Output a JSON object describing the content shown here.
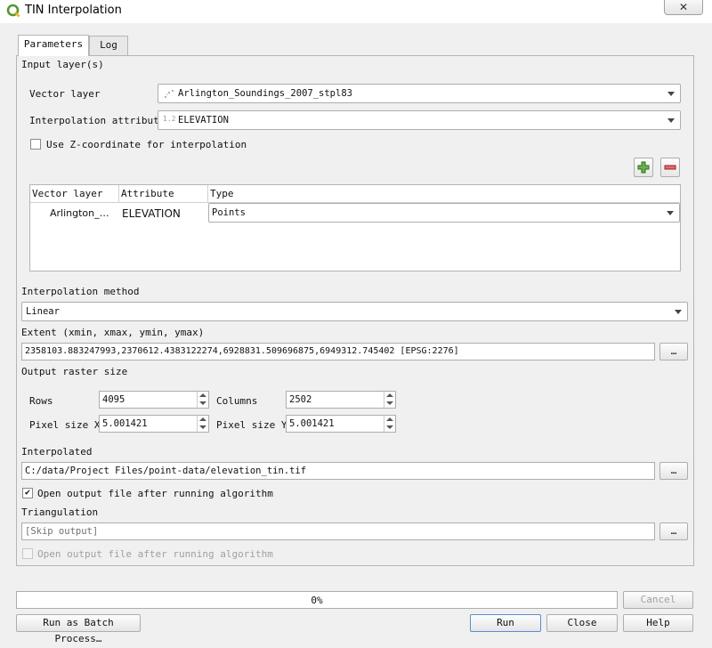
{
  "window": {
    "title": "TIN Interpolation",
    "close_glyph": "✕"
  },
  "tabs": [
    {
      "label": "Parameters",
      "active": true
    },
    {
      "label": "Log",
      "active": false
    }
  ],
  "params": {
    "input_layers_label": "Input layer(s)",
    "vector_layer_label": "Vector layer",
    "vector_layer_value": "Arlington_Soundings_2007_stpl83",
    "interp_attr_label": "Interpolation attribute",
    "interp_attr_prefix": "1.2",
    "interp_attr_value": "ELEVATION",
    "use_z_label": "Use Z-coordinate for interpolation",
    "use_z_checked": false,
    "table": {
      "headers": [
        "Vector layer",
        "Attribute",
        "Type"
      ],
      "rows": [
        {
          "layer": "Arlington_…",
          "attribute": "ELEVATION",
          "type": "Points"
        }
      ]
    },
    "method_label": "Interpolation method",
    "method_value": "Linear",
    "extent_label": "Extent (xmin, xmax, ymin, ymax)",
    "extent_value": "2358103.883247993,2370612.4383122274,6928831.509696875,6949312.745402 [EPSG:2276]",
    "raster_size_label": "Output raster size",
    "rows_label": "Rows",
    "rows_value": "4095",
    "columns_label": "Columns",
    "columns_value": "2502",
    "pixel_x_label": "Pixel size X",
    "pixel_x_value": "5.001421",
    "pixel_y_label": "Pixel size Y",
    "pixel_y_value": "5.001421",
    "interpolated_label": "Interpolated",
    "interpolated_value": "C:/data/Project Files/point-data/elevation_tin.tif",
    "open_output_label": "Open output file after running algorithm",
    "open_output_checked": "✔",
    "triangulation_label": "Triangulation",
    "triangulation_placeholder": "[Skip output]",
    "open_output2_label": "Open output file after running algorithm",
    "browse_label": "…"
  },
  "progress": {
    "text": "0%",
    "value": 0
  },
  "buttons": {
    "cancel": "Cancel",
    "batch": "Run as Batch Process…",
    "run": "Run",
    "close": "Close",
    "help": "Help"
  },
  "colors": {
    "qgis_green": "#589632",
    "remove_red": "#d9534f"
  }
}
